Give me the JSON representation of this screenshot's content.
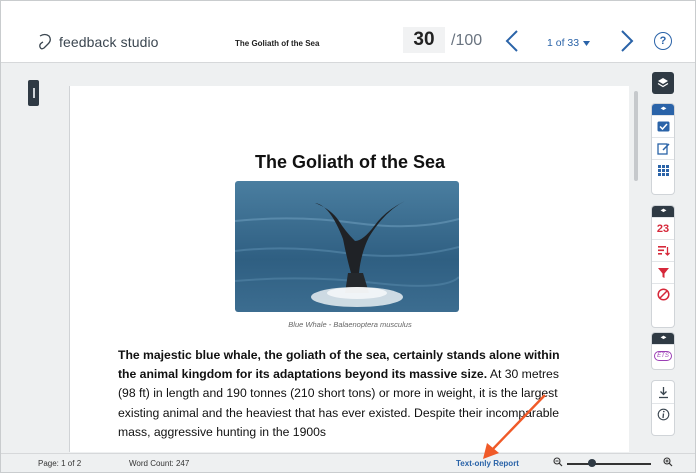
{
  "header": {
    "logo_text": "feedback studio",
    "doc_title": "The Goliath of the Sea",
    "grade": "30",
    "grade_max": "/100",
    "paper_counter": "1 of 33",
    "help_symbol": "?"
  },
  "document": {
    "heading": "The Goliath of the Sea",
    "image_caption": "Blue Whale - Balaenoptera musculus",
    "paragraph_bold": "The majestic blue whale, the goliath of the sea, certainly stands alone within the animal kingdom for its adaptations beyond its massive size.",
    "paragraph_rest": " At 30 metres (98 ft) in length and 190 tonnes (210 short tons) or more in weight, it is the largest existing animal and the heaviest that has ever existed. Despite their incomparable mass, aggressive hunting in the 1900s"
  },
  "tools": {
    "similarity_score": "23",
    "etc_label": "ETS"
  },
  "footer": {
    "page_info": "Page: 1 of 2",
    "word_count": "Word Count: 247",
    "text_only_link": "Text-only Report",
    "zoom_level": 0.3
  },
  "colors": {
    "accent_blue": "#2a63a8",
    "similarity_red": "#d6283a",
    "etc_purple": "#9b3fb5",
    "dark_panel": "#2f3a44",
    "annotation_arrow": "#f05a28"
  },
  "icons": [
    "feedback-studio-logo-icon",
    "chevron-left-icon",
    "chevron-right-icon",
    "caret-down-icon",
    "help-icon",
    "layers-icon",
    "checkmark-icon",
    "edit-icon",
    "grid-icon",
    "filter-icon",
    "funnel-icon",
    "no-entry-icon",
    "download-icon",
    "info-icon",
    "zoom-out-icon",
    "zoom-in-icon"
  ]
}
